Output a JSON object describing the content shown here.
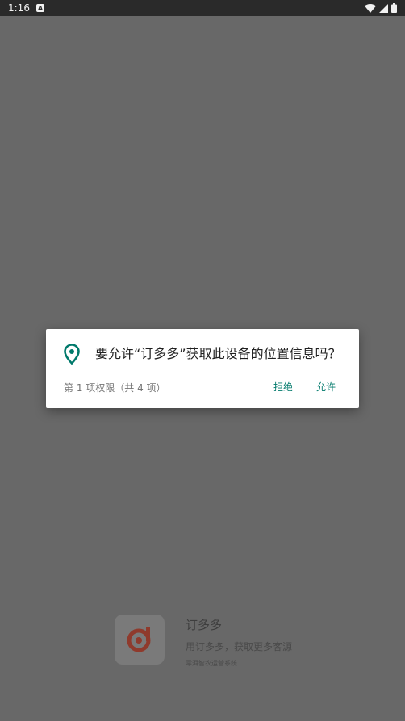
{
  "status_bar": {
    "time": "1:16",
    "notification_icon": "a-icon",
    "icons": [
      "wifi-icon",
      "signal-icon",
      "battery-icon"
    ]
  },
  "splash": {
    "app_name": "订多多",
    "slogan": "用订多多，获取更多客源",
    "subline": "零湃智农运营系统"
  },
  "dialog": {
    "icon": "location-pin-icon",
    "title": "要允许“订多多”获取此设备的位置信息吗？",
    "counter": "第 1 项权限（共 4 项）",
    "deny_label": "拒绝",
    "allow_label": "允许"
  },
  "colors": {
    "accent": "#00796b",
    "scrim": "#686868",
    "status_bar": "#2a2a2a"
  }
}
